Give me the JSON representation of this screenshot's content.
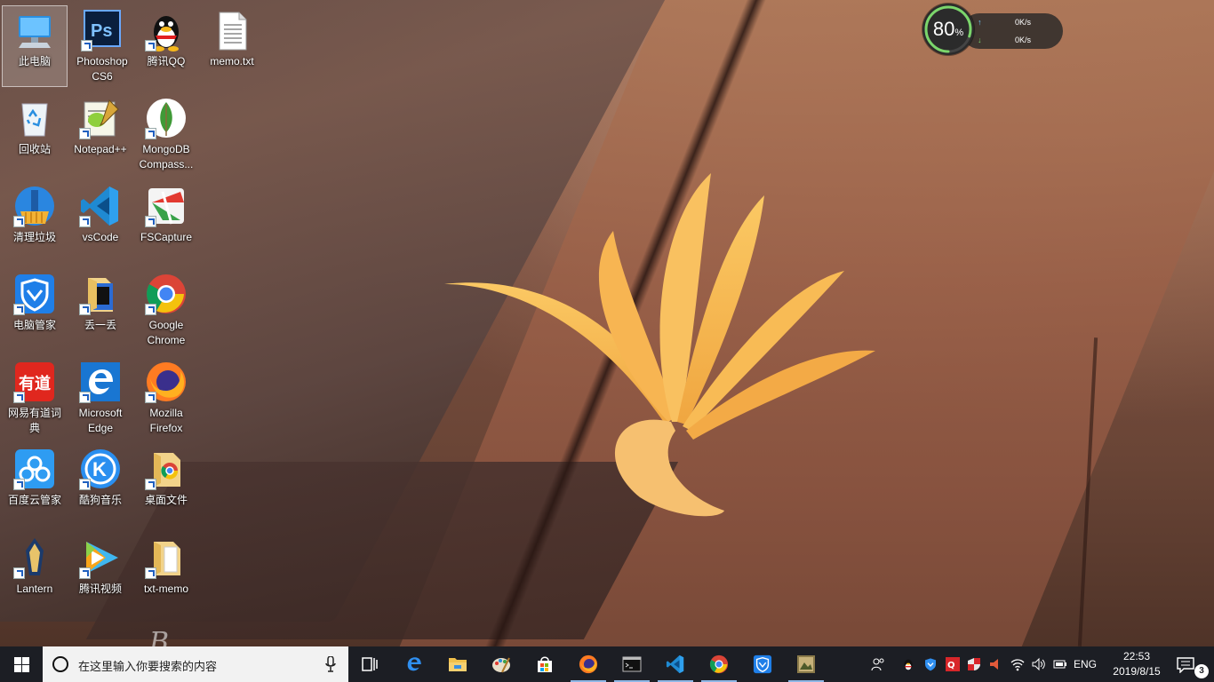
{
  "desktop": {
    "icons": [
      {
        "label": "此电脑",
        "icon": "computer-icon"
      },
      {
        "label": "Photoshop\nCS6",
        "icon": "photoshop-icon"
      },
      {
        "label": "腾讯QQ",
        "icon": "qq-penguin-icon"
      },
      {
        "label": "memo.txt",
        "icon": "text-file-icon"
      },
      {
        "label": "回收站",
        "icon": "recycle-bin-icon"
      },
      {
        "label": "Notepad++",
        "icon": "notepadpp-icon"
      },
      {
        "label": "MongoDB\nCompass...",
        "icon": "mongodb-leaf-icon"
      },
      {
        "label": "清理垃圾",
        "icon": "broom-icon"
      },
      {
        "label": "vsCode",
        "icon": "vscode-icon"
      },
      {
        "label": "FSCapture",
        "icon": "fscapture-icon"
      },
      {
        "label": "电脑管家",
        "icon": "tencent-shield-icon"
      },
      {
        "label": "丢一丢",
        "icon": "folder-icon"
      },
      {
        "label": "Google\nChrome",
        "icon": "chrome-icon"
      },
      {
        "label": "网易有道词\n典",
        "icon": "youdao-icon"
      },
      {
        "label": "Microsoft\nEdge",
        "icon": "edge-icon"
      },
      {
        "label": "Mozilla\nFirefox",
        "icon": "firefox-icon"
      },
      {
        "label": "百度云管家",
        "icon": "baidu-cloud-icon"
      },
      {
        "label": "酷狗音乐",
        "icon": "kugou-icon"
      },
      {
        "label": "桌面文件",
        "icon": "folder-chrome-icon"
      },
      {
        "label": "Lantern",
        "icon": "lantern-icon"
      },
      {
        "label": "腾讯视频",
        "icon": "tencent-video-icon"
      },
      {
        "label": "txt-memo",
        "icon": "folder-icon"
      }
    ]
  },
  "net_monitor": {
    "percent": "80",
    "percent_unit": "%",
    "upload_speed": "0K/s",
    "download_speed": "0K/s",
    "up_arrow": "↑",
    "down_arrow": "↓",
    "level": 0.8
  },
  "taskbar": {
    "search_placeholder": "在这里输入你要搜索的内容",
    "pinned": [
      {
        "name": "task-view-icon"
      },
      {
        "name": "edge-icon"
      },
      {
        "name": "file-explorer-icon"
      },
      {
        "name": "paint-icon"
      },
      {
        "name": "store-icon"
      },
      {
        "name": "firefox-icon"
      },
      {
        "name": "cmd-icon"
      },
      {
        "name": "vscode-icon"
      },
      {
        "name": "chrome-icon"
      },
      {
        "name": "tencent-shield-icon"
      },
      {
        "name": "image-viewer-icon"
      }
    ],
    "tray": {
      "language": "ENG",
      "time": "22:53",
      "date": "2019/8/15",
      "notification_count": "3"
    }
  },
  "wallpaper": {
    "signature": "B"
  },
  "colors": {
    "taskbar_bg": "#1c1e24",
    "accent": "#0078d7",
    "flower": "#f6b64a"
  }
}
